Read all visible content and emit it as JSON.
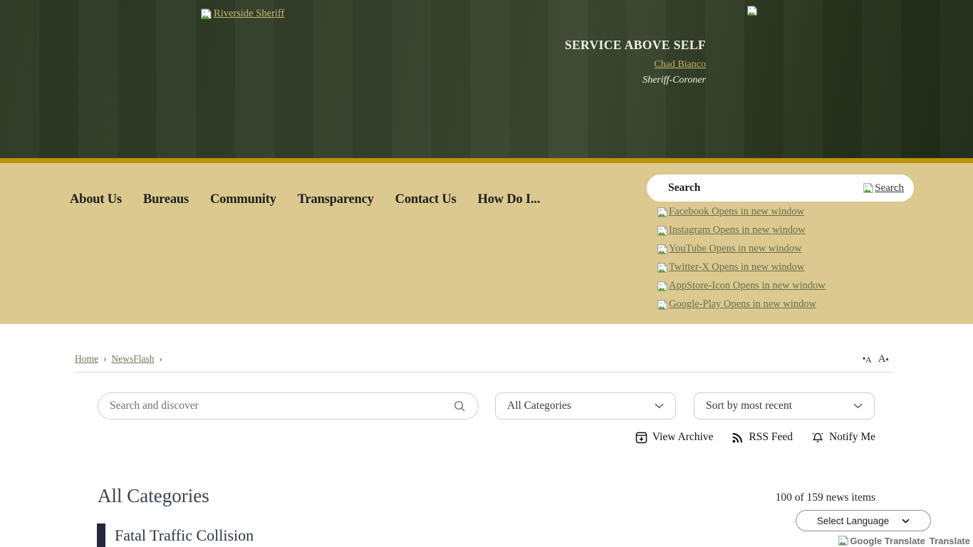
{
  "header": {
    "logo_alt": "Riverside Sheriff",
    "motto": "SERVICE ABOVE SELF",
    "sheriff_name": "Chad Bianco",
    "sheriff_title": "Sheriff-Coroner"
  },
  "nav": {
    "items": [
      {
        "label": "About Us"
      },
      {
        "label": "Bureaus"
      },
      {
        "label": "Community"
      },
      {
        "label": "Transparency"
      },
      {
        "label": "Contact Us"
      },
      {
        "label": "How Do I..."
      }
    ],
    "search_value": "Search",
    "search_link_label": "Search"
  },
  "social": {
    "links": [
      {
        "label": "Facebook Opens in new window"
      },
      {
        "label": "Instagram Opens in new window"
      },
      {
        "label": "YouTube Opens in new window"
      },
      {
        "label": "Twitter-X Opens in new window"
      },
      {
        "label": "AppStore-Icon Opens in new window"
      },
      {
        "label": "Google-Play Opens in new window"
      }
    ]
  },
  "breadcrumb": {
    "items": [
      {
        "label": "Home"
      },
      {
        "label": "NewsFlash"
      }
    ],
    "separator": "›"
  },
  "font_size": {
    "decrease_arrow": "▾",
    "decrease_label": "A",
    "increase_label": "A",
    "increase_arrow": "▴"
  },
  "filters": {
    "search_placeholder": "Search and discover",
    "category_selected": "All Categories",
    "sort_selected": "Sort by most recent"
  },
  "actions": {
    "view_archive": "View Archive",
    "rss_feed": "RSS Feed",
    "notify_me": "Notify Me"
  },
  "content": {
    "heading": "All Categories",
    "items_count": "100 of 159 news items",
    "news_items": [
      {
        "title": "Fatal Traffic Collision"
      }
    ]
  },
  "translate": {
    "select_label": "Select Language",
    "logo_alt": "Google Translate",
    "label": "Translate"
  },
  "colors": {
    "header_green": "#2e3a24",
    "gold_stripe": "#b8940e",
    "tan_band": "#dbc98f",
    "olive_link": "#68704f",
    "gold_link": "#c9b577",
    "news_accent": "#23293a"
  }
}
